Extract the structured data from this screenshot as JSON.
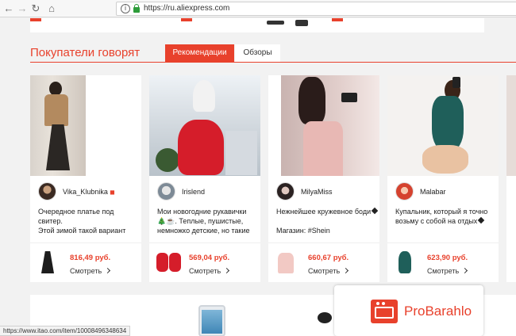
{
  "browser": {
    "url": "https://ru.aliexpress.com",
    "back_icon": "arrow-left-icon",
    "forward_icon": "arrow-right-icon",
    "reload_icon": "reload-icon",
    "home_icon": "home-icon"
  },
  "section": {
    "title": "Покупатели говорят",
    "tabs": [
      {
        "label": "Рекомендации",
        "active": true
      },
      {
        "label": "Обзоры",
        "active": false
      }
    ]
  },
  "reviews": [
    {
      "user": "Vika_Klubnika",
      "lines": [
        "Очередное платье под",
        "свитер.",
        "Этой зимой такой вариант"
      ],
      "price": "816,49 руб.",
      "view": "Смотреть"
    },
    {
      "user": "Irislend",
      "lines": [
        "Мои новогодние рукавички",
        "🎄☕. Теплые, пушистые,",
        "немножко детские, но такие"
      ],
      "price": "569,04 руб.",
      "view": "Смотреть"
    },
    {
      "user": "MilyaMiss",
      "lines": [
        "Нежнейшее кружевное боди",
        "",
        "Магазин: #Shein"
      ],
      "price": "660,67 руб.",
      "view": "Смотреть"
    },
    {
      "user": "Malabar",
      "lines": [
        "Купальник, который я точно",
        "возьму с собой на отдых"
      ],
      "price": "623,90 руб.",
      "view": "Смотреть"
    }
  ],
  "status_url": "https://www.itao.com/item/10008496348634",
  "watermark": "ProBarahlo",
  "colors": {
    "accent": "#e8412c",
    "background": "#f2f2f2"
  }
}
